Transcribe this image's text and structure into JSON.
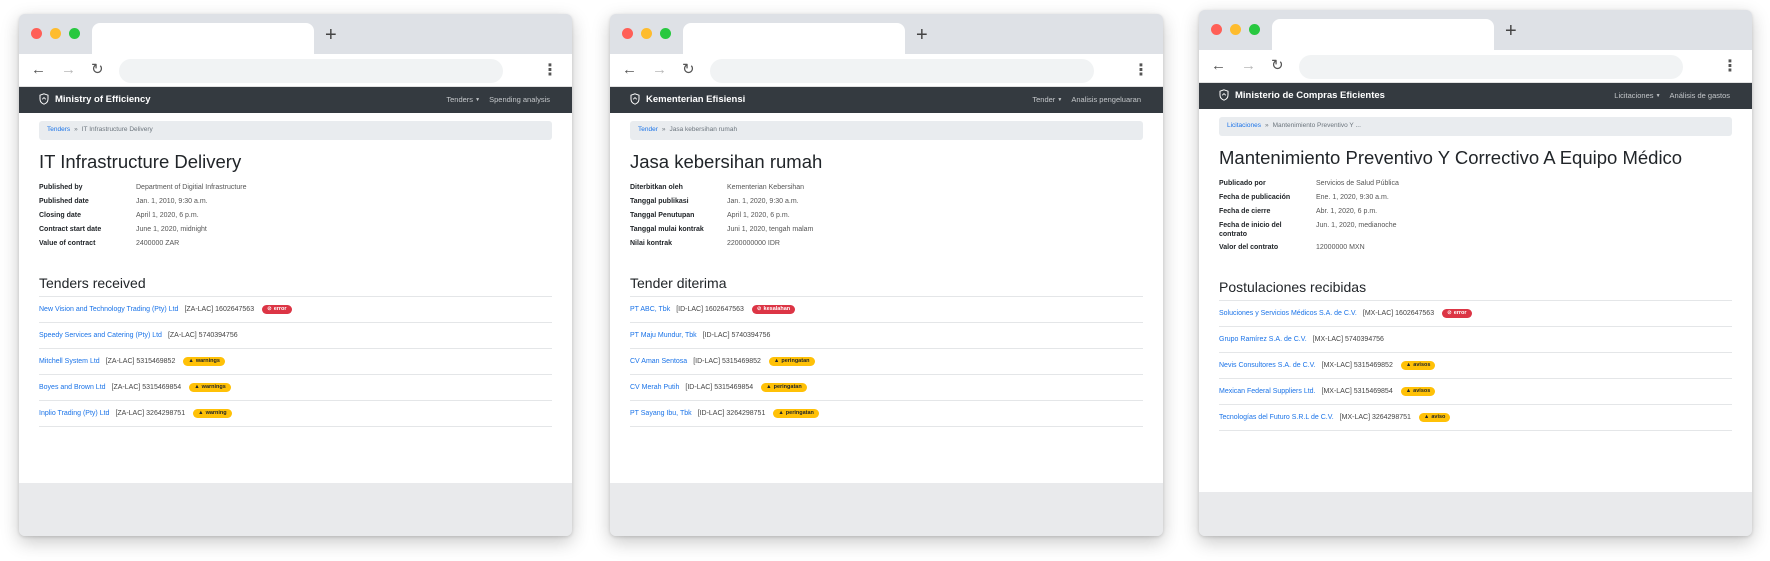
{
  "windows": [
    {
      "site_name": "Ministry of Efficiency",
      "nav": {
        "tenders": "Tenders",
        "spending": "Spending analysis"
      },
      "breadcrumb": {
        "root": "Tenders",
        "sep": "»",
        "current": "IT Infrastructure Delivery"
      },
      "title": "IT Infrastructure Delivery",
      "facts": [
        {
          "k": "Published by",
          "v": "Department of Digitial Infrastructure"
        },
        {
          "k": "Published date",
          "v": "Jan. 1, 2010, 9:30 a.m."
        },
        {
          "k": "Closing date",
          "v": "April 1, 2020, 6 p.m."
        },
        {
          "k": "Contract start date",
          "v": "June 1, 2020, midnight"
        },
        {
          "k": "Value of contract",
          "v": "2400000 ZAR"
        }
      ],
      "tenders_heading": "Tenders received",
      "tenders": [
        {
          "name": "New Vision and Technology Trading (Pty) Ltd",
          "code": "[ZA-LAC] 1602647563",
          "badge": "error",
          "type": "err"
        },
        {
          "name": "Speedy Services and Catering (Pty) Ltd",
          "code": "[ZA-LAC] 5740394756",
          "badge": "",
          "type": ""
        },
        {
          "name": "Mitchell System Ltd",
          "code": "[ZA-LAC] 5315469852",
          "badge": "warnings",
          "type": "warn"
        },
        {
          "name": "Boyes and Brown Ltd",
          "code": "[ZA-LAC] 5315469854",
          "badge": "warnings",
          "type": "warn"
        },
        {
          "name": "Inplio Trading (Pty) Ltd",
          "code": "[ZA-LAC] 3264298751",
          "badge": "warning",
          "type": "warn"
        }
      ]
    },
    {
      "site_name": "Kementerian Efisiensi",
      "nav": {
        "tenders": "Tender",
        "spending": "Analisis pengeluaran"
      },
      "breadcrumb": {
        "root": "Tender",
        "sep": "»",
        "current": "Jasa kebersihan rumah"
      },
      "title": "Jasa kebersihan rumah",
      "facts": [
        {
          "k": "Diterbitkan oleh",
          "v": "Kementerian Kebersihan"
        },
        {
          "k": "Tanggal publikasi",
          "v": "Jan. 1, 2020, 9:30 a.m."
        },
        {
          "k": "Tanggal Penutupan",
          "v": "April 1, 2020, 6 p.m."
        },
        {
          "k": "Tanggal mulai kontrak",
          "v": "Juni 1, 2020, tengah malam"
        },
        {
          "k": "Nilai kontrak",
          "v": "2200000000 IDR"
        }
      ],
      "tenders_heading": "Tender diterima",
      "tenders": [
        {
          "name": "PT ABC, Tbk",
          "code": "[ID-LAC] 1602647563",
          "badge": "kesalahan",
          "type": "err"
        },
        {
          "name": "PT Maju Mundur, Tbk",
          "code": "[ID-LAC] 5740394756",
          "badge": "",
          "type": ""
        },
        {
          "name": "CV Aman Sentosa",
          "code": "[ID-LAC] 5315469852",
          "badge": "peringatan",
          "type": "warn"
        },
        {
          "name": "CV Merah Putih",
          "code": "[ID-LAC] 5315469854",
          "badge": "peringatan",
          "type": "warn"
        },
        {
          "name": "PT Sayang Ibu, Tbk",
          "code": "[ID-LAC] 3264298751",
          "badge": "peringatan",
          "type": "warn"
        }
      ]
    },
    {
      "site_name": "Ministerio de Compras Eficientes",
      "nav": {
        "tenders": "Licitaciones",
        "spending": "Análisis de gastos"
      },
      "breadcrumb": {
        "root": "Licitaciones",
        "sep": "»",
        "current": "Mantenimiento Preventivo Y ..."
      },
      "title": "Mantenimiento Preventivo Y Correctivo A Equipo Médico",
      "facts": [
        {
          "k": "Publicado por",
          "v": "Servicios de Salud Pública"
        },
        {
          "k": "Fecha de publicación",
          "v": "Ene. 1, 2020, 9:30 a.m."
        },
        {
          "k": "Fecha de cierre",
          "v": "Abr. 1, 2020, 6 p.m."
        },
        {
          "k": "Fecha de inicio del contrato",
          "v": "Jun. 1, 2020, medianoche"
        },
        {
          "k": "Valor del contrato",
          "v": "12000000 MXN"
        }
      ],
      "tenders_heading": "Postulaciones recibidas",
      "tenders": [
        {
          "name": "Soluciones y Servicios Médicos S.A. de C.V.",
          "code": "[MX-LAC] 1602647563",
          "badge": "error",
          "type": "err"
        },
        {
          "name": "Grupo Ramírez S.A. de C.V.",
          "code": "[MX-LAC] 5740394756",
          "badge": "",
          "type": ""
        },
        {
          "name": "Nevis Consultores S.A. de C.V.",
          "code": "[MX-LAC] 5315469852",
          "badge": "avisos",
          "type": "warn"
        },
        {
          "name": "Mexican Federal Suppliers Ltd.",
          "code": "[MX-LAC] 5315469854",
          "badge": "avisos",
          "type": "warn"
        },
        {
          "name": "Tecnologías del Futuro S.R.L de C.V.",
          "code": "[MX-LAC] 3264298751",
          "badge": "aviso",
          "type": "warn"
        }
      ]
    }
  ],
  "icons": {
    "back": "arrow-left-icon",
    "forward": "arrow-right-icon",
    "reload": "reload-icon",
    "menu": "kebab-menu-icon",
    "new_tab": "plus-icon",
    "brand": "shield-logo-icon",
    "error": "error-circle-icon",
    "warning": "warning-triangle-icon"
  },
  "glyphs": {
    "back": "←",
    "forward": "→",
    "reload": "↻",
    "menu": "⋮",
    "new_tab": "+",
    "caret": "▼",
    "error": "⊘",
    "warning": "▲"
  }
}
